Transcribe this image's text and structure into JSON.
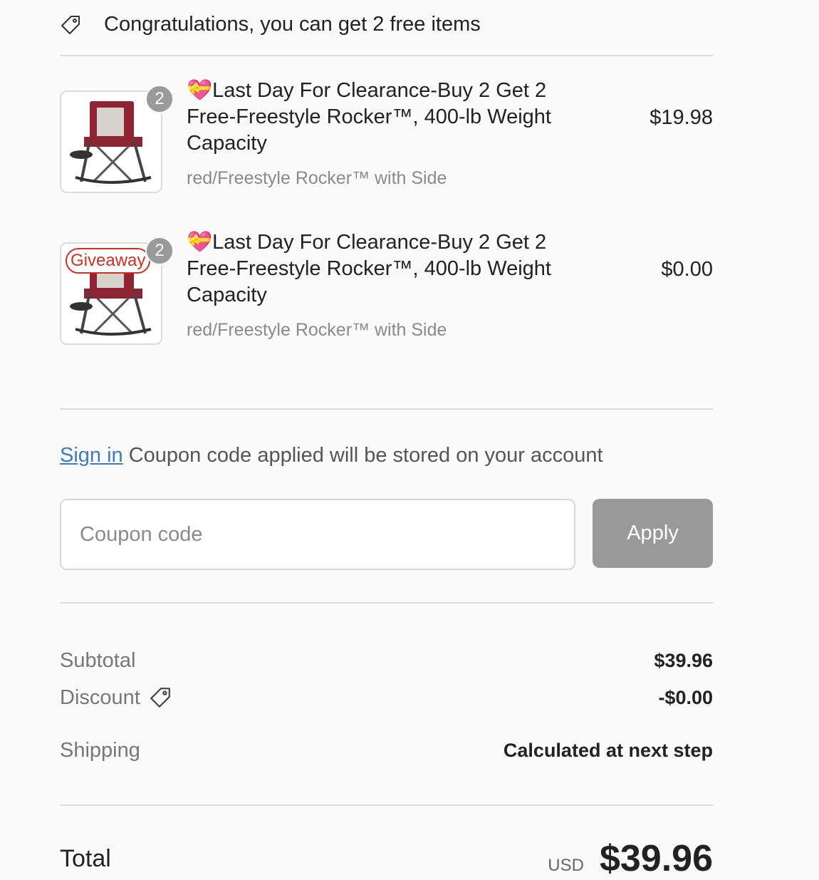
{
  "banner": {
    "text": "Congratulations, you can get 2 free items",
    "icon": "tag-icon"
  },
  "items": [
    {
      "quantity": "2",
      "title": "💝Last Day For Clearance-Buy 2 Get 2 Free-Freestyle Rocker™, 400-lb Weight Capacity",
      "variant": "red/Freestyle Rocker™ with Side",
      "price": "$19.98",
      "badge": ""
    },
    {
      "quantity": "2",
      "title": "💝Last Day For Clearance-Buy 2 Get 2 Free-Freestyle Rocker™, 400-lb Weight Capacity",
      "variant": "red/Freestyle Rocker™ with Side",
      "price": "$0.00",
      "badge": "Giveaway"
    }
  ],
  "signin": {
    "link": "Sign in",
    "text": " Coupon code applied will be stored on your account"
  },
  "coupon": {
    "placeholder": "Coupon code",
    "value": "",
    "apply_label": "Apply"
  },
  "summary": {
    "subtotal_label": "Subtotal",
    "subtotal_value": "$39.96",
    "discount_label": "Discount",
    "discount_value": "-$0.00",
    "shipping_label": "Shipping",
    "shipping_value": "Calculated at next step"
  },
  "total": {
    "label": "Total",
    "currency": "USD",
    "amount": "$39.96"
  },
  "colors": {
    "accent_link": "#3d7dbf",
    "giveaway_red": "#d0301f",
    "button_gray": "#999999",
    "chair_red": "#8e2433"
  }
}
